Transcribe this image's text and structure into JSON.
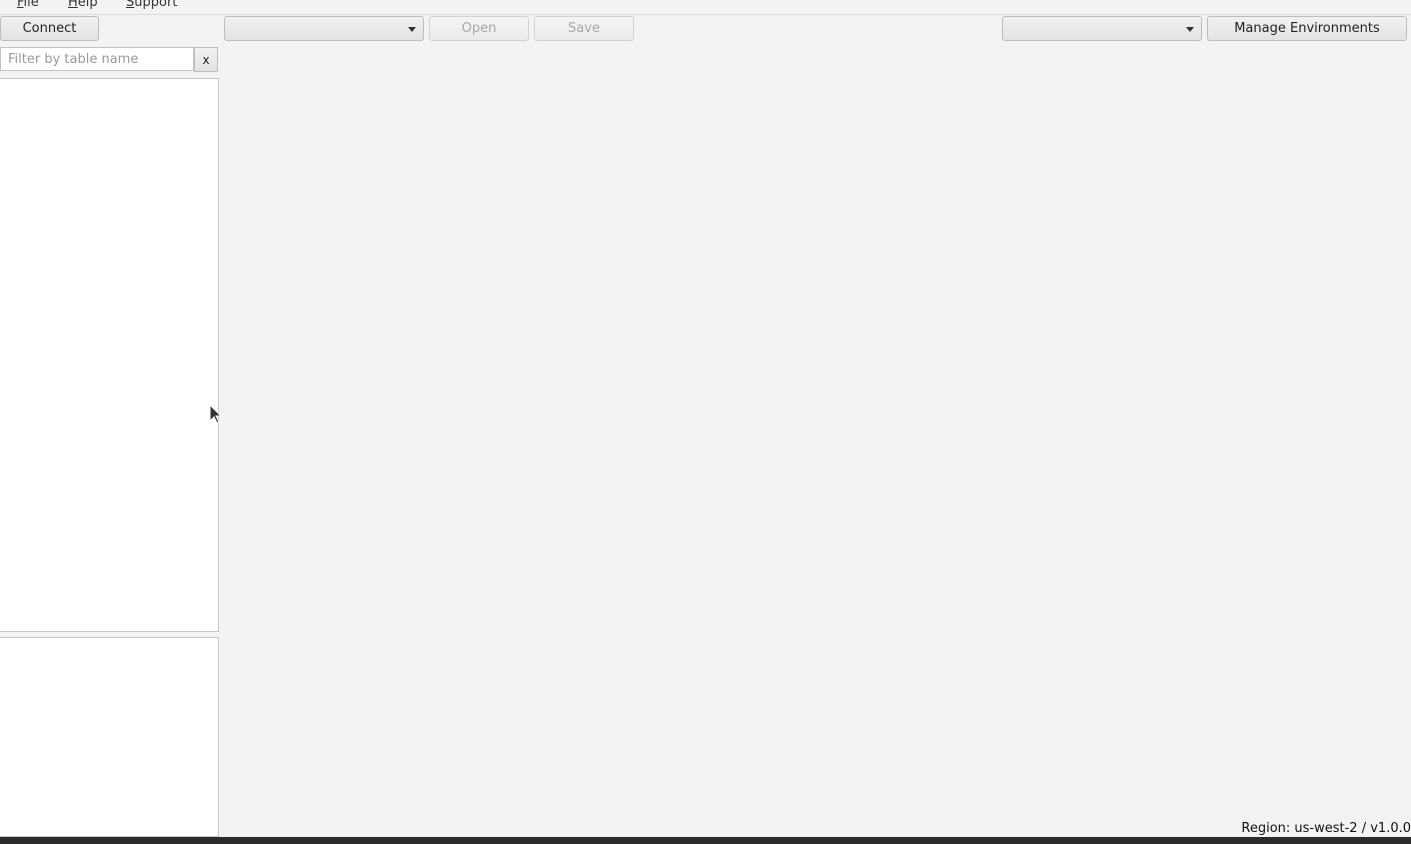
{
  "menubar": {
    "items": [
      {
        "mnemonic": "F",
        "rest": "ile"
      },
      {
        "mnemonic": "H",
        "rest": "elp"
      },
      {
        "mnemonic": "S",
        "rest": "upport"
      }
    ]
  },
  "toolbar": {
    "connect_label": "Connect",
    "table_combo_value": "",
    "open_label": "Open",
    "save_label": "Save",
    "environment_combo_value": "",
    "manage_environments_label": "Manage Environments"
  },
  "sidebar": {
    "filter_placeholder": "Filter by table name",
    "filter_value": "",
    "clear_label": "x"
  },
  "status": {
    "text": "Region: us-west-2 / v1.0.0"
  }
}
